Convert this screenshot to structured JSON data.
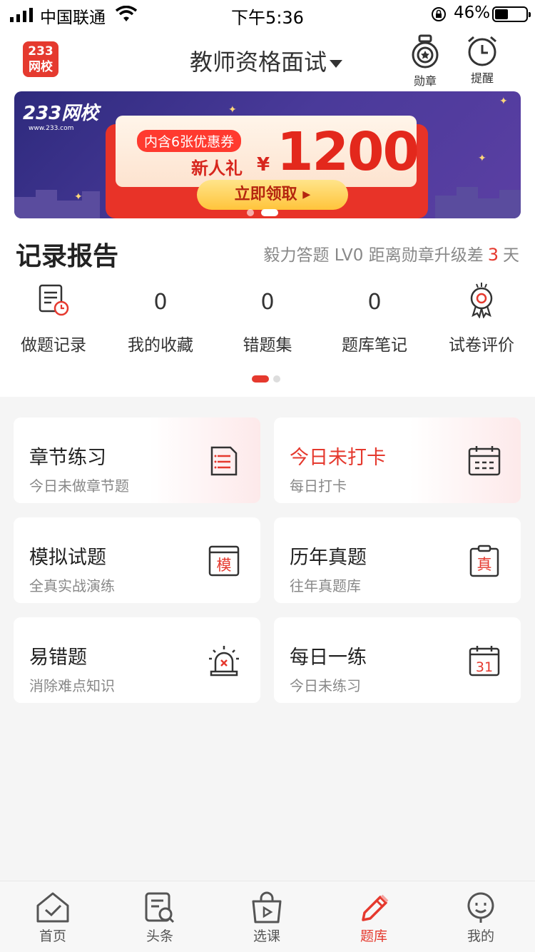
{
  "status_bar": {
    "carrier": "中国联通",
    "time": "下午5:36",
    "battery": "46%"
  },
  "header": {
    "logo_line1": "233",
    "logo_line2": "网校",
    "title": "教师资格面试",
    "medal_label": "勋章",
    "reminder_label": "提醒"
  },
  "banner": {
    "brand": "233网校",
    "brand_url": "www.233.com",
    "coupon": "内含6张优惠券",
    "gift": "新人礼",
    "currency": "¥",
    "amount": "1200",
    "cta": "立即领取 ▸"
  },
  "record": {
    "title": "记录报告",
    "note_prefix": "毅力答题 LV0 距离勋章升级差",
    "note_days": "3",
    "note_suffix": "天",
    "stats": [
      {
        "label": "做题记录",
        "icon": "record-icon"
      },
      {
        "label": "我的收藏",
        "value": "0"
      },
      {
        "label": "错题集",
        "value": "0"
      },
      {
        "label": "题库笔记",
        "value": "0"
      },
      {
        "label": "试卷评价",
        "icon": "award-icon"
      }
    ]
  },
  "cards": [
    {
      "title": "章节练习",
      "subtitle": "今日未做章节题",
      "icon": "list-doc-icon"
    },
    {
      "title": "今日未打卡",
      "subtitle": "每日打卡",
      "icon": "calendar-icon"
    },
    {
      "title": "模拟试题",
      "subtitle": "全真实战演练",
      "icon": "mock-icon",
      "icon_text": "模"
    },
    {
      "title": "历年真题",
      "subtitle": "往年真题库",
      "icon": "clipboard-icon",
      "icon_text": "真"
    },
    {
      "title": "易错题",
      "subtitle": "消除难点知识",
      "icon": "alarm-icon"
    },
    {
      "title": "每日一练",
      "subtitle": "今日未练习",
      "icon": "calendar-31-icon",
      "icon_text": "31"
    }
  ],
  "nav": [
    {
      "label": "首页",
      "icon": "home-icon"
    },
    {
      "label": "头条",
      "icon": "news-icon"
    },
    {
      "label": "选课",
      "icon": "course-bag-icon"
    },
    {
      "label": "题库",
      "icon": "pencil-icon",
      "active": true
    },
    {
      "label": "我的",
      "icon": "profile-icon"
    }
  ],
  "colors": {
    "accent": "#e5392e",
    "background": "#f5f5f5"
  }
}
